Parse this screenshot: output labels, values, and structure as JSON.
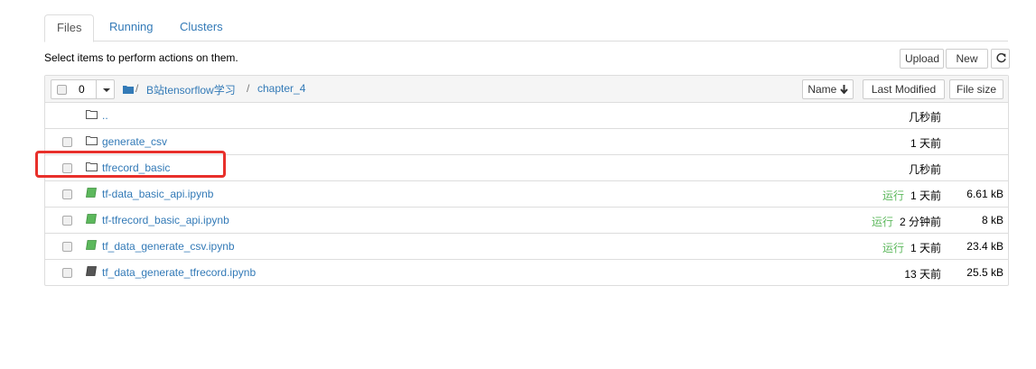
{
  "tabs": [
    {
      "label": "Files",
      "active": true
    },
    {
      "label": "Running",
      "active": false
    },
    {
      "label": "Clusters",
      "active": false
    }
  ],
  "hint": "Select items to perform actions on them.",
  "toolbar": {
    "upload_label": "Upload",
    "new_label": "New",
    "refresh_icon": "refresh-icon"
  },
  "selector": {
    "count": "0"
  },
  "breadcrumb": {
    "sep": "/",
    "items": [
      "B站tensorflow学习",
      "chapter_4"
    ]
  },
  "columns": {
    "name": "Name",
    "last_modified": "Last Modified",
    "file_size": "File size"
  },
  "rows": [
    {
      "name": "..",
      "type": "folder",
      "running": "",
      "modified": "几秒前",
      "size": ""
    },
    {
      "name": "generate_csv",
      "type": "folder",
      "running": "",
      "modified": "1 天前",
      "size": ""
    },
    {
      "name": "tfrecord_basic",
      "type": "folder",
      "running": "",
      "modified": "几秒前",
      "size": ""
    },
    {
      "name": "tf-data_basic_api.ipynb",
      "type": "notebook-running",
      "running": "运行",
      "modified": "1 天前",
      "size": "6.61 kB"
    },
    {
      "name": "tf-tfrecord_basic_api.ipynb",
      "type": "notebook-running",
      "running": "运行",
      "modified": "2 分钟前",
      "size": "8 kB"
    },
    {
      "name": "tf_data_generate_csv.ipynb",
      "type": "notebook-running",
      "running": "运行",
      "modified": "1 天前",
      "size": "23.4 kB"
    },
    {
      "name": "tf_data_generate_tfrecord.ipynb",
      "type": "notebook",
      "running": "",
      "modified": "13 天前",
      "size": "25.5 kB"
    }
  ],
  "colors": {
    "link": "#337ab7",
    "running": "#5cb85c",
    "highlight": "#e8302b"
  }
}
